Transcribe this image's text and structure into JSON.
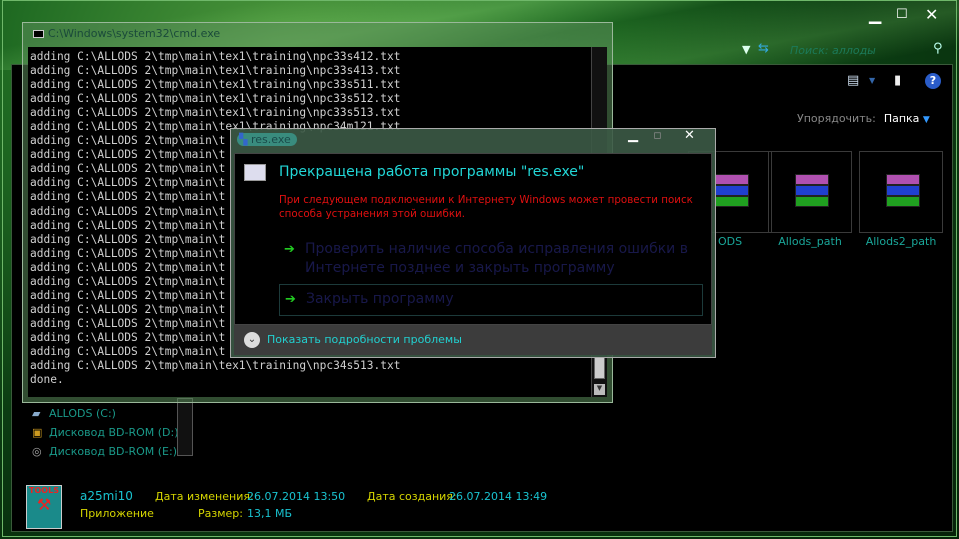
{
  "explorer": {
    "search_placeholder": "Поиск: аллоды",
    "sort_label": "Упорядочить:",
    "sort_value": "Папка",
    "tiles": [
      {
        "label": "ODS"
      },
      {
        "label": "Allods_path"
      },
      {
        "label": "Allods2_path"
      }
    ],
    "nav_items": [
      {
        "label": "ALLODS (C:)"
      },
      {
        "label": "Дисковод BD-ROM (D:) C"
      },
      {
        "label": "Дисковод BD-ROM (E:) H"
      }
    ],
    "details": {
      "name": "a25mi10",
      "type": "Приложение",
      "modified_label": "Дата изменения:",
      "modified_value": "26.07.2014 13:50",
      "created_label": "Дата создания:",
      "created_value": "26.07.2014 13:49",
      "size_label": "Размер:",
      "size_value": "13,1 МБ"
    }
  },
  "cmd": {
    "title": "C:\\Windows\\system32\\cmd.exe",
    "lines": [
      "adding C:\\ALLODS 2\\tmp\\main\\tex1\\training\\npc33s412.txt",
      "adding C:\\ALLODS 2\\tmp\\main\\tex1\\training\\npc33s413.txt",
      "adding C:\\ALLODS 2\\tmp\\main\\tex1\\training\\npc33s511.txt",
      "adding C:\\ALLODS 2\\tmp\\main\\tex1\\training\\npc33s512.txt",
      "adding C:\\ALLODS 2\\tmp\\main\\tex1\\training\\npc33s513.txt",
      "adding C:\\ALLODS 2\\tmp\\main\\tex1\\training\\npc34m121.txt",
      "adding C:\\ALLODS 2\\tmp\\main\\t",
      "adding C:\\ALLODS 2\\tmp\\main\\t",
      "adding C:\\ALLODS 2\\tmp\\main\\t",
      "adding C:\\ALLODS 2\\tmp\\main\\t",
      "adding C:\\ALLODS 2\\tmp\\main\\t",
      "adding C:\\ALLODS 2\\tmp\\main\\t",
      "adding C:\\ALLODS 2\\tmp\\main\\t",
      "adding C:\\ALLODS 2\\tmp\\main\\t",
      "adding C:\\ALLODS 2\\tmp\\main\\t",
      "adding C:\\ALLODS 2\\tmp\\main\\t",
      "adding C:\\ALLODS 2\\tmp\\main\\t",
      "adding C:\\ALLODS 2\\tmp\\main\\t",
      "adding C:\\ALLODS 2\\tmp\\main\\t",
      "adding C:\\ALLODS 2\\tmp\\main\\t",
      "adding C:\\ALLODS 2\\tmp\\main\\t",
      "adding C:\\ALLODS 2\\tmp\\main\\t",
      "adding C:\\ALLODS 2\\tmp\\main\\tex1\\training\\npc34s513.txt",
      "done."
    ]
  },
  "dialog": {
    "title": "res.exe",
    "heading": "Прекращена работа программы \"res.exe\"",
    "message": "При следующем подключении к Интернету Windows может провести поиск способа устранения этой ошибки.",
    "option_check": "Проверить наличие способа исправления ошибки в Интернете позднее и закрыть программу",
    "option_close": "Закрыть программу",
    "details_toggle": "Показать подробности проблемы"
  }
}
